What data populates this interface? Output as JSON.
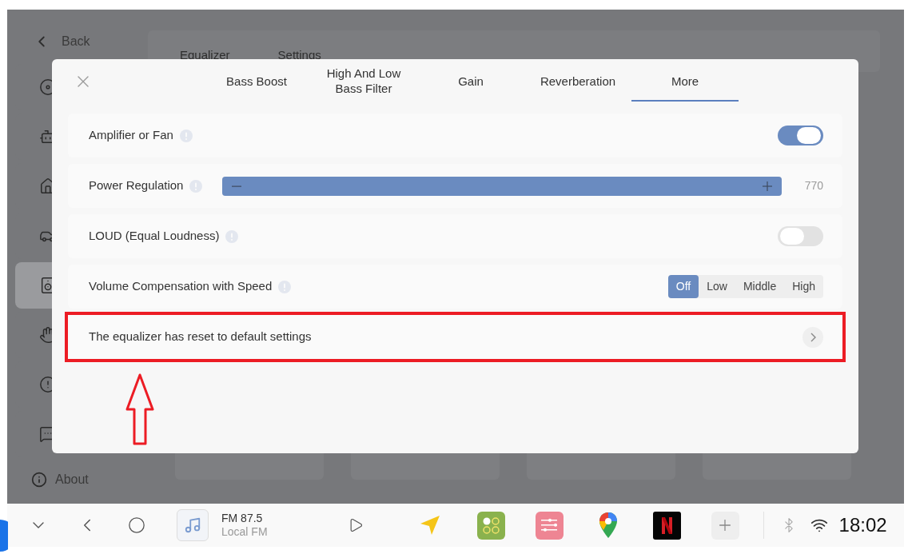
{
  "background": {
    "back_label": "Back",
    "sidebar": {
      "items": [
        {
          "selected": false
        },
        {
          "selected": false
        },
        {
          "selected": false
        },
        {
          "selected": false
        },
        {
          "selected": true
        },
        {
          "selected": false
        },
        {
          "selected": false
        },
        {
          "selected": false
        }
      ],
      "about_label": "About"
    },
    "tabs": [
      {
        "label": "Equalizer"
      },
      {
        "label": "Settings"
      }
    ]
  },
  "dialog": {
    "tabs": [
      {
        "label": "Bass Boost",
        "selected": false
      },
      {
        "label": "High And Low Bass Filter",
        "selected": false
      },
      {
        "label": "Gain",
        "selected": false
      },
      {
        "label": "Reverberation",
        "selected": false
      },
      {
        "label": "More",
        "selected": true
      }
    ],
    "rows": [
      {
        "kind": "toggle",
        "label": "Amplifier or Fan",
        "info": true,
        "on": true,
        "highlighted": false
      },
      {
        "kind": "slider",
        "label": "Power Regulation",
        "info": true,
        "level": 1,
        "reading": "770",
        "highlighted": false
      },
      {
        "kind": "toggle",
        "label": "LOUD (Equal Loudness)",
        "info": true,
        "on": false,
        "highlighted": false
      },
      {
        "kind": "segmented",
        "label": "Volume Compensation with Speed",
        "info": true,
        "options": [
          {
            "label": "Off",
            "selected": true
          },
          {
            "label": "Low",
            "selected": false
          },
          {
            "label": "Middle",
            "selected": false
          },
          {
            "label": "High",
            "selected": false
          }
        ],
        "highlighted": false
      },
      {
        "kind": "link",
        "label": "The equalizer has reset to default settings",
        "info": false,
        "highlighted": true
      }
    ]
  },
  "taskbar": {
    "media": {
      "title": "FM 87.5",
      "subtitle": "Local FM"
    },
    "clock": "18:02"
  }
}
